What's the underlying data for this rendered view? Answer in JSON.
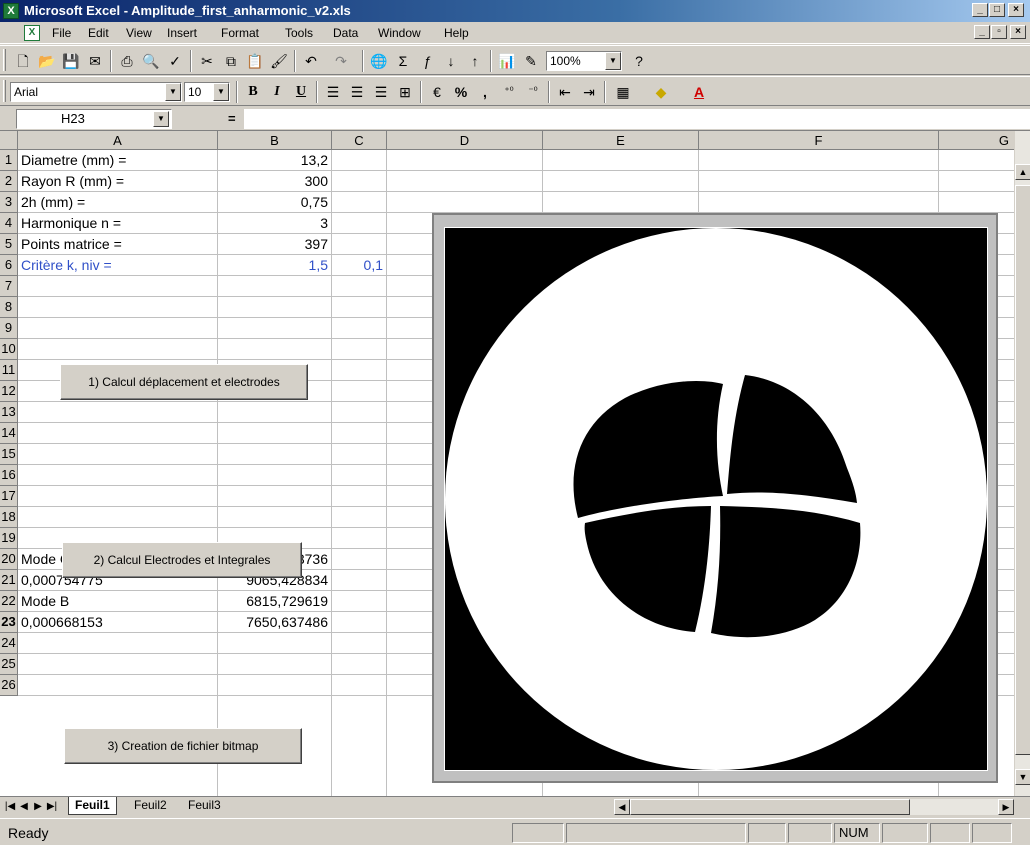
{
  "window": {
    "title": "Microsoft Excel - Amplitude_first_anharmonic_v2.xls"
  },
  "menu": [
    "File",
    "Edit",
    "View",
    "Insert",
    "Format",
    "Tools",
    "Data",
    "Window",
    "Help"
  ],
  "toolbar1": {
    "zoom": "100%"
  },
  "toolbar2": {
    "font": "Arial",
    "size": "10"
  },
  "formula_bar": {
    "name_box": "H23",
    "equals": "=",
    "formula": ""
  },
  "columns": [
    "A",
    "B",
    "C",
    "D",
    "E",
    "F",
    "G"
  ],
  "rows": [
    "1",
    "2",
    "3",
    "4",
    "5",
    "6",
    "7",
    "8",
    "9",
    "10",
    "11",
    "12",
    "13",
    "14",
    "15",
    "16",
    "17",
    "18",
    "19",
    "20",
    "21",
    "22",
    "23",
    "24",
    "25",
    "26"
  ],
  "active_row": "23",
  "cells": {
    "a1": "Diametre (mm) =",
    "b1": "13,2",
    "a2": "Rayon R (mm) =",
    "b2": "300",
    "a3": "2h (mm) =",
    "b3": "0,75",
    "a4": "Harmonique n =",
    "b4": "3",
    "a5": "Points matrice  =",
    "b5": "397",
    "a6": "Critère k, niv =",
    "b6": "1,5",
    "c6": "0,1",
    "a20": "Mode C",
    "b20": "9123,143736",
    "a21": "0,000754775",
    "b21": "9065,428834",
    "a22": "Mode B",
    "b22": "6815,729619",
    "a23": "0,000668153",
    "b23": "7650,637486"
  },
  "buttons": {
    "btn1": "1) Calcul déplacement et electrodes",
    "btn2": "2) Calcul Electrodes et Integrales",
    "btn3": "3) Creation de fichier bitmap"
  },
  "sheet_tabs": [
    "Feuil1",
    "Feuil2",
    "Feuil3"
  ],
  "active_sheet": "Feuil1",
  "status": {
    "ready": "Ready",
    "num": "NUM"
  },
  "colors": {
    "title_bar": "#0a246a",
    "highlight_text": "#3050c8",
    "picture_bg": "#000000",
    "picture_fg": "#ffffff"
  }
}
